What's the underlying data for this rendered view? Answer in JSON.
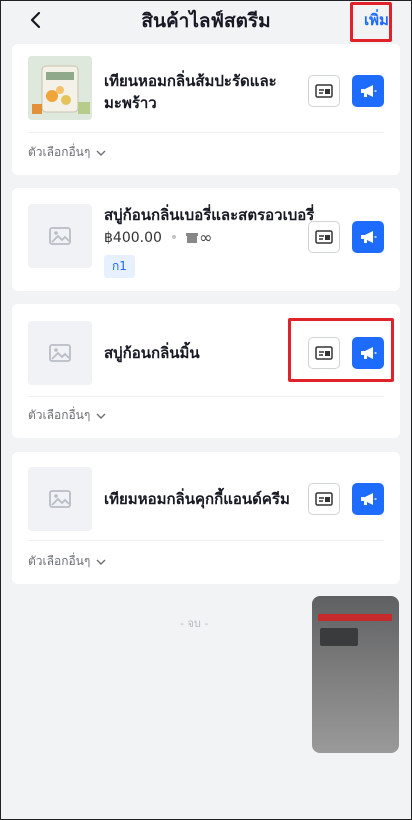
{
  "header": {
    "title": "สินค้าไลฟ์สตรีม",
    "add_label": "เพิ่ม"
  },
  "products": [
    {
      "name_line1": "เทียนหอมกลิ่นส้มปะรัดและ",
      "name_line2": "มะพร้าว",
      "options_label": "ตัวเลือกอื่นๆ"
    },
    {
      "name": "สบู่ก้อนกลิ่นเบอรี่และสตรอวเบอรี่",
      "price": "฿400.00",
      "stock": "∞",
      "tag": "ก1"
    },
    {
      "name": "สบู่ก้อนกลิ่นมิ้น",
      "options_label": "ตัวเลือกอื่นๆ"
    },
    {
      "name": "เทียมหอมกลิ่นคุกกี้แอนด์ครีม",
      "options_label": "ตัวเลือกอื่นๆ"
    }
  ],
  "footer": {
    "end_label": "- จบ -"
  },
  "colors": {
    "accent": "#1e6bff",
    "highlight": "#e0232a",
    "background": "#f2f3f5"
  },
  "icons": {
    "back": "chevron-left-icon",
    "manage": "product-card-icon",
    "announce": "megaphone-icon",
    "placeholder": "image-placeholder-icon",
    "expand": "chevron-down-icon"
  }
}
